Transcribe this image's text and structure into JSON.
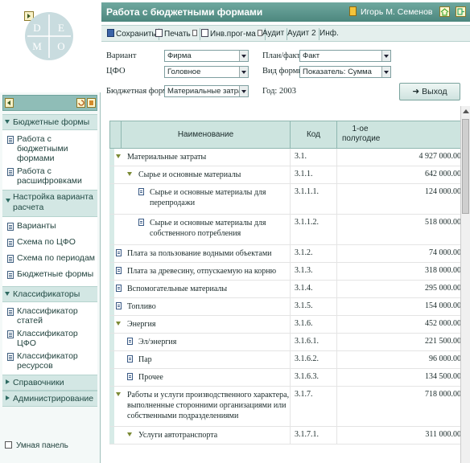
{
  "sidebar": {
    "logo_letters": [
      "D",
      "E",
      "M",
      "O"
    ],
    "sections": [
      {
        "label": "Бюджетные формы",
        "expanded": true,
        "items": [
          "Работа с бюджетными формами",
          "Работа с расшифровками"
        ]
      },
      {
        "label": "Настройка варианта расчета",
        "expanded": true,
        "items": [
          "Варианты",
          "Схема по ЦФО",
          "Схема по периодам",
          "Бюджетные формы"
        ]
      },
      {
        "label": "Классификаторы",
        "expanded": true,
        "items": [
          "Классификатор статей",
          "Классификатор ЦФО",
          "Классификатор ресурсов"
        ]
      },
      {
        "label": "Справочники",
        "expanded": false,
        "items": []
      },
      {
        "label": "Администрирование",
        "expanded": false,
        "items": []
      }
    ],
    "smart_panel_label": "Умная панель"
  },
  "header": {
    "title": "Работа с бюджетными формами",
    "user": "Игорь М. Семенов"
  },
  "toolbar": {
    "save": "Сохранить",
    "print": "Печать",
    "inv": "Инв.прог-ма",
    "audit": "Аудит",
    "audit2": "Аудит 2",
    "info": "Инф."
  },
  "filters": {
    "variant_label": "Вариант",
    "variant_value": "Фирма",
    "cfo_label": "ЦФО",
    "cfo_value": "Головное",
    "form_label": "Бюджетная форма",
    "form_value": "Материальные затраты",
    "year_text": "Год: 2003",
    "planfact_label": "План/факт",
    "planfact_value": "Факт",
    "view_label": "Вид формы",
    "view_value": "Показатель: Сумма",
    "exit_label": "Выход"
  },
  "table": {
    "headers": {
      "name": "Наименование",
      "code": "Код",
      "period": "1-ое полугодие"
    },
    "rows": [
      {
        "name": "Материальные затраты",
        "code": "3.1.",
        "value": "4 927 000.00",
        "indent": 0,
        "icon": "triangle"
      },
      {
        "name": "Сырье и основные материалы",
        "code": "3.1.1.",
        "value": "642 000.00",
        "indent": 1,
        "icon": "triangle"
      },
      {
        "name": "Сырье и основные материалы для перепродажи",
        "code": "3.1.1.1.",
        "value": "124 000.00",
        "indent": 2,
        "icon": "doc",
        "lines": 2
      },
      {
        "name": "Сырье и основные материалы для собственного потребления",
        "code": "3.1.1.2.",
        "value": "518 000.00",
        "indent": 2,
        "icon": "doc",
        "lines": 2
      },
      {
        "name": "Плата за пользование водными объектами",
        "code": "3.1.2.",
        "value": "74 000.00",
        "indent": 0,
        "icon": "doc"
      },
      {
        "name": "Плата за древесину, отпускаемую на корню",
        "code": "3.1.3.",
        "value": "318 000.00",
        "indent": 0,
        "icon": "doc"
      },
      {
        "name": "Вспомогательные материалы",
        "code": "3.1.4.",
        "value": "295 000.00",
        "indent": 0,
        "icon": "doc"
      },
      {
        "name": "Топливо",
        "code": "3.1.5.",
        "value": "154 000.00",
        "indent": 0,
        "icon": "doc"
      },
      {
        "name": "Энергия",
        "code": "3.1.6.",
        "value": "452 000.00",
        "indent": 0,
        "icon": "triangle"
      },
      {
        "name": "Эл/энергия",
        "code": "3.1.6.1.",
        "value": "221 500.00",
        "indent": 1,
        "icon": "doc"
      },
      {
        "name": "Пар",
        "code": "3.1.6.2.",
        "value": "96 000.00",
        "indent": 1,
        "icon": "doc"
      },
      {
        "name": "Прочее",
        "code": "3.1.6.3.",
        "value": "134 500.00",
        "indent": 1,
        "icon": "doc"
      },
      {
        "name": "Работы и услуги производственного характера, выполненные сторонними организациями или собственными подразделениями",
        "code": "3.1.7.",
        "value": "718 000.00",
        "indent": 0,
        "icon": "triangle",
        "lines": 3
      },
      {
        "name": "Услуги автотранспорта",
        "code": "3.1.7.1.",
        "value": "311 000.00",
        "indent": 1,
        "icon": "triangle"
      }
    ]
  },
  "colors": {
    "accent": "#5a958c",
    "panel": "#d3e7e4",
    "header_cell": "#cde4df"
  }
}
